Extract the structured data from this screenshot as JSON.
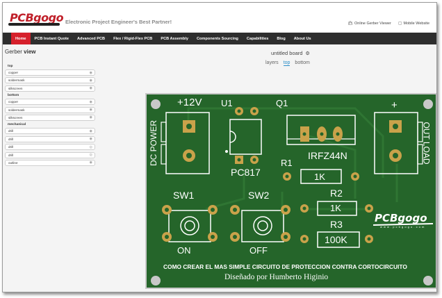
{
  "header": {
    "logo": "PCBgogo",
    "tagline": "Electronic Project Engineer's Best Partner!",
    "links": [
      {
        "label": "Online Gerber Viewer",
        "icon": "bag-icon"
      },
      {
        "label": "Mobile Website",
        "icon": "mobile-icon"
      }
    ]
  },
  "nav": {
    "items": [
      {
        "label": "Home",
        "active": true
      },
      {
        "label": "PCB Instant Quote"
      },
      {
        "label": "Advanced PCB"
      },
      {
        "label": "Flex / Rigid-Flex PCB"
      },
      {
        "label": "PCB Assembly"
      },
      {
        "label": "Components Sourcing"
      },
      {
        "label": "Capabilities"
      },
      {
        "label": "Blog"
      },
      {
        "label": "About Us"
      }
    ],
    "active_color": "#d6202b",
    "bar_color": "#2e2e2e"
  },
  "sidebar": {
    "title_prefix": "Gerber",
    "title_bold": "view",
    "groups": [
      {
        "label": "top",
        "layers": [
          "copper",
          "soldermask",
          "silkscreen"
        ]
      },
      {
        "label": "bottom",
        "layers": [
          "copper",
          "soldermask",
          "silkscreen"
        ]
      },
      {
        "label": "mechanical",
        "layers": [
          "drill",
          "drill",
          "drill",
          "drill",
          "outline"
        ]
      }
    ]
  },
  "viewer": {
    "board_name": "untitled board",
    "tabs": [
      {
        "label": "layers"
      },
      {
        "label": "top",
        "active": true
      },
      {
        "label": "bottom"
      }
    ],
    "accent": "#2c8fc9"
  },
  "pcb": {
    "board_color": "#25652a",
    "pad_color": "#c9a24a",
    "silk": {
      "v12": "+12V",
      "u1": "U1",
      "q1": "Q1",
      "plus": "+",
      "dc_power": "DC POWER",
      "out_load": "OUT LOAD",
      "irfz44n": "IRFZ44N",
      "r1": "R1",
      "r1_value": "1K",
      "pc817": "PC817",
      "sw1": "SW1",
      "sw2": "SW2",
      "r2": "R2",
      "r2_value": "1K",
      "r3": "R3",
      "r3_value": "100K",
      "on": "ON",
      "off": "OFF",
      "footer_line1": "COMO CREAR EL MAS SIMPLE CIRCUITO DE PROTECCION CONTRA CORTOCIRCUITO",
      "footer_line2": "Diseñado por Humberto Higinio",
      "logo": "PCBgogo",
      "logo_url": "w w w . p c b g o g o . c o m"
    }
  }
}
